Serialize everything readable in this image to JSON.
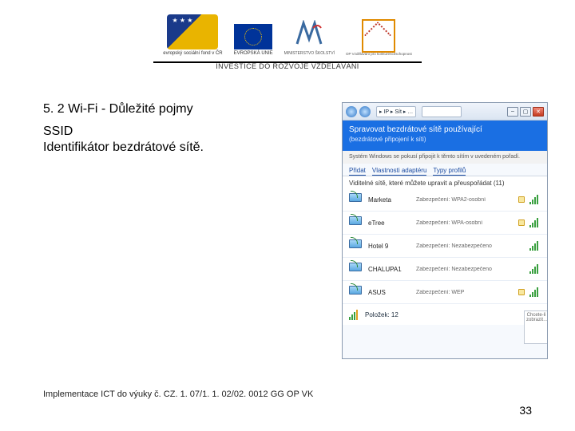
{
  "header": {
    "tagline": "INVESTICE DO ROZVOJE VZDĚLÁVÁNÍ",
    "logos": {
      "esf_label": "evropský\nsociální\nfond v ČR",
      "eu_label": "EVROPSKÁ UNIE",
      "msmt_label": "MINISTERSTVO ŠKOLSTVÍ",
      "op_label": "OP Vzdělávání pro konkurenceschopnost"
    }
  },
  "content": {
    "heading": "5. 2 Wi-Fi - Důležité pojmy",
    "term": "SSID",
    "description": "Identifikátor bezdrátové sítě."
  },
  "window": {
    "address": "▸ IP ▸ Sít ▸ …",
    "title": "Spravovat bezdrátové sítě používající",
    "subtitle": "(bezdrátové připojení k síti)",
    "strip": "Systém Windows se pokusí připojit k těmto sítím v uvedeném pořadí.",
    "tabs": [
      "Přidat",
      "Vlastnosti adaptéru",
      "Typy profilů"
    ],
    "section_label": "Viditelné sítě, které můžete upravit a přeuspořádat (11)",
    "networks": [
      {
        "name": "Marketa",
        "security": "Zabezpečení: WPA2-osobní"
      },
      {
        "name": "eTree",
        "security": "Zabezpečení: WPA-osobní"
      },
      {
        "name": "Hotel 9",
        "security": "Zabezpečení: Nezabezpečeno"
      },
      {
        "name": "CHALUPA1",
        "security": "Zabezpečení: Nezabezpečeno"
      },
      {
        "name": "ASUS",
        "security": "Zabezpečení: WEP"
      }
    ],
    "footer_items": "Položek: 12",
    "side_tab": "Chcete-li zobrazit…"
  },
  "footer": {
    "note": "Implementace ICT do výuky č. CZ. 1. 07/1. 1. 02/02. 0012 GG OP VK",
    "page": "33"
  }
}
